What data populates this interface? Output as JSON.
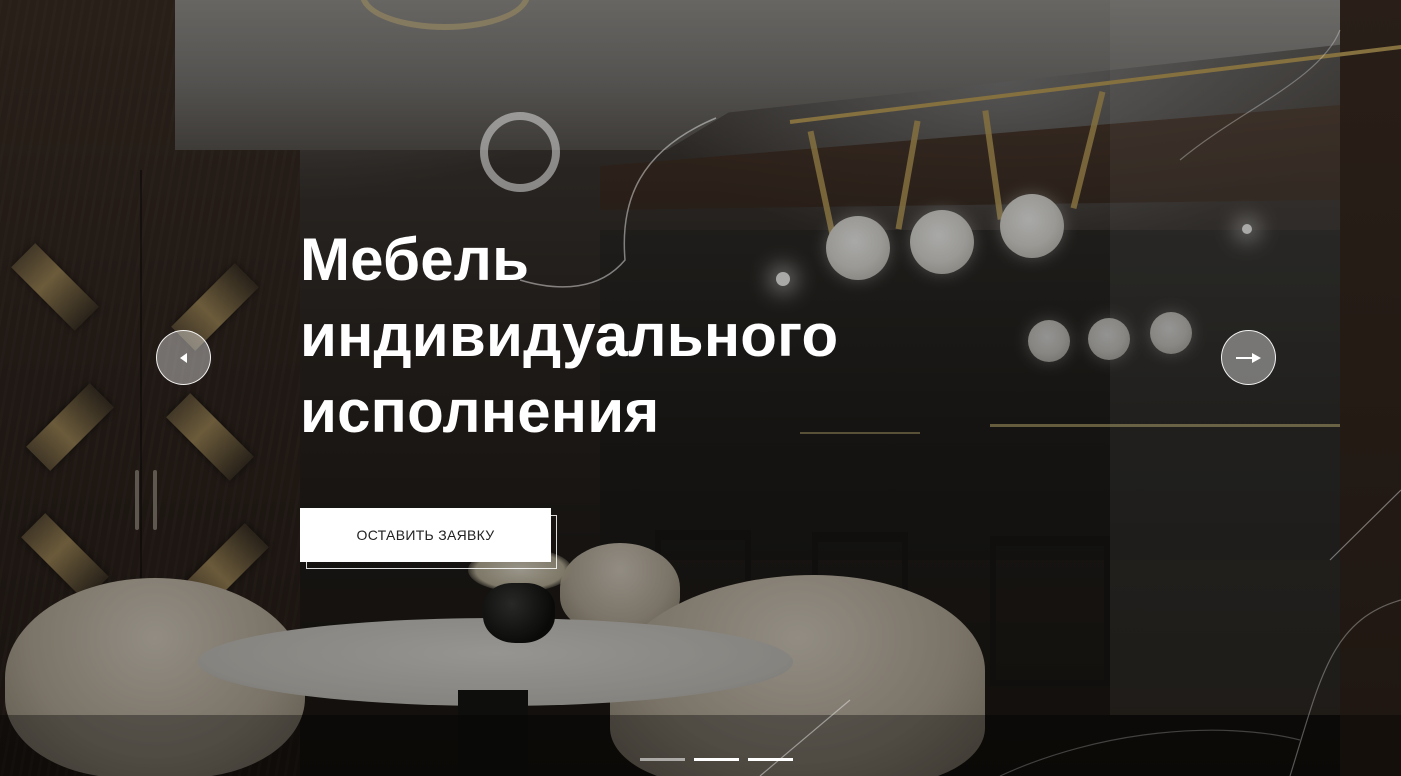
{
  "hero": {
    "headline_lines": [
      "Мебель",
      "индивидуального",
      "исполнения"
    ],
    "cta_label": "ОСТАВИТЬ ЗАЯВКУ"
  },
  "slider": {
    "prev_icon": "arrow-left-icon",
    "next_icon": "arrow-right-icon",
    "slide_count": 3,
    "active_slide": 2
  },
  "colors": {
    "text": "#ffffff",
    "button_bg": "#ffffff",
    "button_text": "#222222",
    "accent_gold": "#c8a85e"
  }
}
